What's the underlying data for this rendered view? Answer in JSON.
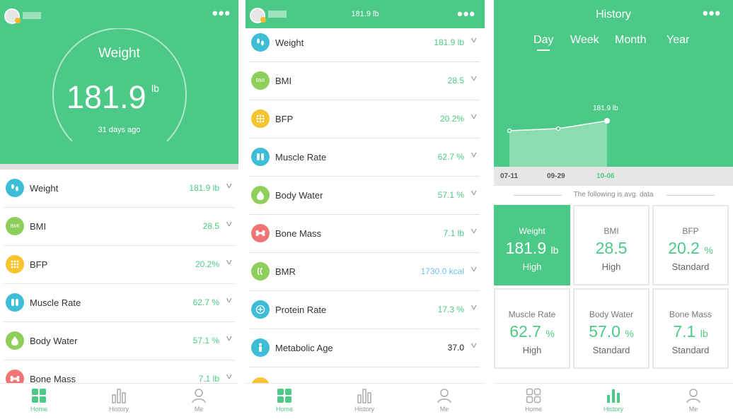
{
  "colors": {
    "brand_green": "#4dc987",
    "bmr_blue": "#6fc3ea",
    "orange": "#f7c32e",
    "red": "#f07676",
    "teal": "#3dbdd6",
    "lime": "#8dcf5a"
  },
  "screen1": {
    "header": {
      "title": "Weight",
      "value": "181.9",
      "unit": "lb",
      "subtitle": "31 days ago",
      "menu_icon": "more-dots-icon"
    },
    "metrics": [
      {
        "label": "Weight",
        "value": "181.9 lb",
        "icon": "footprints-icon"
      },
      {
        "label": "BMI",
        "value": "28.5",
        "icon": "bmi-icon",
        "icon_text": "BMI"
      },
      {
        "label": "BFP",
        "value": "20.2%",
        "icon": "fat-icon"
      },
      {
        "label": "Muscle Rate",
        "value": "62.7 %",
        "icon": "muscle-icon"
      },
      {
        "label": "Body Water",
        "value": "57.1 %",
        "icon": "water-drop-icon"
      },
      {
        "label": "Bone Mass",
        "value": "7.1 lb",
        "icon": "bone-icon"
      }
    ],
    "nav": [
      {
        "label": "Home"
      },
      {
        "label": "History"
      },
      {
        "label": "Me"
      }
    ]
  },
  "screen2": {
    "header": {
      "title": "181.9 lb",
      "menu_icon": "more-dots-icon"
    },
    "metrics": [
      {
        "label": "Weight",
        "value": "181.9 lb",
        "icon": "footprints-icon"
      },
      {
        "label": "BMI",
        "value": "28.5",
        "icon": "bmi-icon",
        "icon_text": "BMI"
      },
      {
        "label": "BFP",
        "value": "20.2%",
        "icon": "fat-icon"
      },
      {
        "label": "Muscle Rate",
        "value": "62.7 %",
        "icon": "muscle-icon"
      },
      {
        "label": "Body Water",
        "value": "57.1 %",
        "icon": "water-drop-icon"
      },
      {
        "label": "Bone Mass",
        "value": "7.1 lb",
        "icon": "bone-icon"
      },
      {
        "label": "BMR",
        "value": "1730.0 kcal",
        "icon": "flame-icon"
      },
      {
        "label": "Protein Rate",
        "value": "17.3 %",
        "icon": "protein-icon"
      },
      {
        "label": "Metabolic Age",
        "value": "37.0",
        "icon": "person-icon"
      }
    ],
    "nav": [
      {
        "label": "Home"
      },
      {
        "label": "History"
      },
      {
        "label": "Me"
      }
    ]
  },
  "screen3": {
    "header": {
      "title": "History",
      "menu_icon": "more-dots-icon"
    },
    "tabs": [
      {
        "label": "Day",
        "active": true
      },
      {
        "label": "Week"
      },
      {
        "label": "Month"
      },
      {
        "label": "Year"
      }
    ],
    "chart_data": {
      "type": "area",
      "x": [
        "07-11",
        "09-29",
        "10-06"
      ],
      "annotation": "181.9 lb",
      "selected": "10-06"
    },
    "avg_text": "The following is avg. data",
    "cells": [
      {
        "name": "Weight",
        "value": "181.9",
        "unit": "lb",
        "status": "High"
      },
      {
        "name": "BMI",
        "value": "28.5",
        "unit": "",
        "status": "High"
      },
      {
        "name": "BFP",
        "value": "20.2",
        "unit": "%",
        "status": "Standard"
      },
      {
        "name": "Muscle Rate",
        "value": "62.7",
        "unit": "%",
        "status": "High"
      },
      {
        "name": "Body Water",
        "value": "57.0",
        "unit": "%",
        "status": "Standard"
      },
      {
        "name": "Bone Mass",
        "value": "7.1",
        "unit": "lb",
        "status": "Standard"
      }
    ],
    "nav": [
      {
        "label": "Home"
      },
      {
        "label": "History"
      },
      {
        "label": "Me"
      }
    ]
  }
}
